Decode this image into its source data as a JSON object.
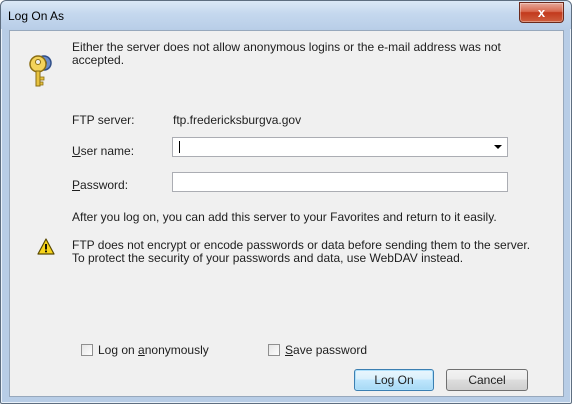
{
  "window": {
    "title": "Log On As",
    "close_glyph": "x"
  },
  "message": {
    "icon": "keys-icon",
    "text": "Either the server does not allow anonymous logins or the e-mail address was not accepted."
  },
  "ftp_server": {
    "label": "FTP server:",
    "value": "ftp.fredericksburgva.gov"
  },
  "user_name": {
    "label_first": "U",
    "label_rest": "ser name:",
    "value": ""
  },
  "password": {
    "label_first": "P",
    "label_rest": "assword:",
    "value": ""
  },
  "info_text": "After you log on, you can add this server to your Favorites and return to it easily.",
  "warning": {
    "icon": "warning-icon",
    "text": "FTP does not encrypt or encode passwords or data before sending them to the server.  To protect the security of your passwords and data, use WebDAV instead."
  },
  "checkboxes": {
    "anonymous_pre": "Log on ",
    "anonymous_ul": "a",
    "anonymous_post": "nonymously",
    "save_ul": "S",
    "save_post": "ave password"
  },
  "buttons": {
    "log_on": "Log On",
    "cancel": "Cancel"
  }
}
